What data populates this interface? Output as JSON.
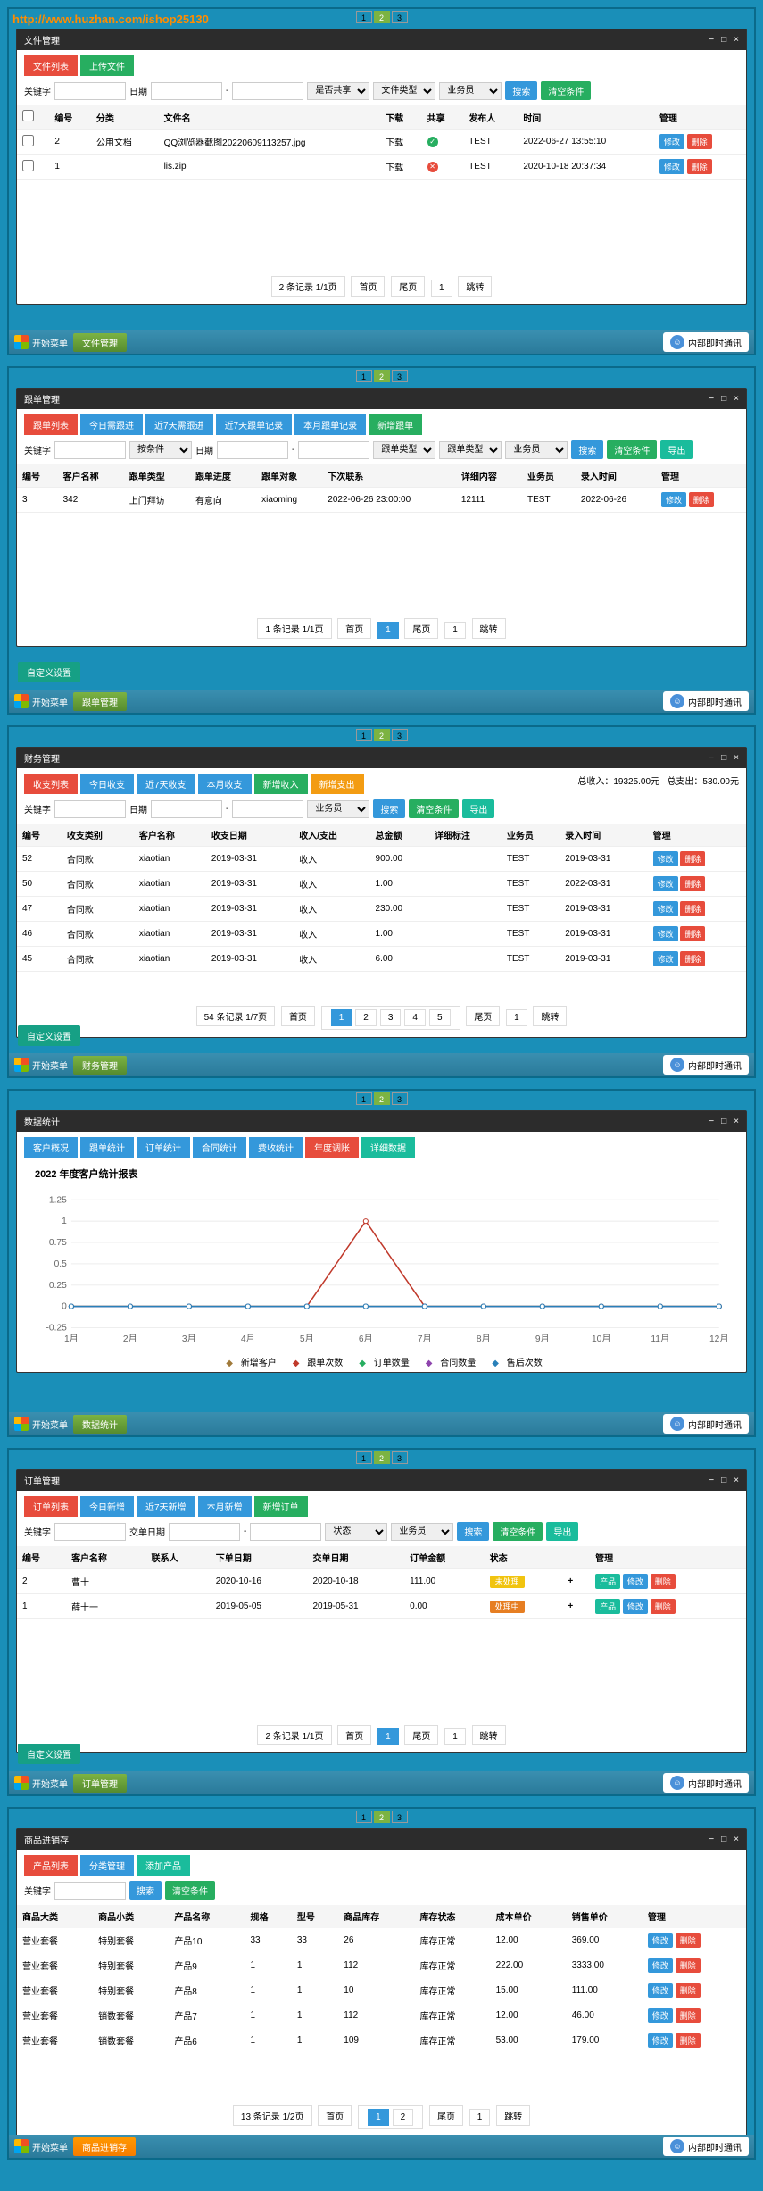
{
  "url_watermark": "http://www.huzhan.com/ishop25130",
  "top_pager": [
    "1",
    "2",
    "3"
  ],
  "taskbar": {
    "start": "开始菜单",
    "im": "内部即时通讯"
  },
  "common": {
    "keyword_label": "关键字",
    "search": "搜索",
    "clear": "清空条件",
    "export": "导出",
    "first_page": "首页",
    "last_page": "尾页",
    "jump": "跳转",
    "edit": "修改",
    "delete": "删除",
    "product": "产品",
    "custom_settings": "自定义设置",
    "manage": "管理",
    "download": "下载"
  },
  "s1": {
    "title": "文件管理",
    "tabs": [
      "文件列表",
      "上传文件"
    ],
    "selects": [
      "是否共享",
      "文件类型",
      "业务员"
    ],
    "task": "文件管理",
    "cols": [
      "编号",
      "分类",
      "文件名",
      "下载",
      "共享",
      "发布人",
      "时间",
      "管理"
    ],
    "pager_text": "2 条记录 1/1页",
    "rows": [
      {
        "id": "2",
        "cat": "公用文档",
        "name": "QQ浏览器截图20220609113257.jpg",
        "share": "✓",
        "pub": "TEST",
        "time": "2022-06-27 13:55:10"
      },
      {
        "id": "1",
        "cat": "",
        "name": "lis.zip",
        "share": "✕",
        "pub": "TEST",
        "time": "2020-10-18 20:37:34"
      }
    ]
  },
  "s2": {
    "title": "跟单管理",
    "tabs": [
      "跟单列表",
      "今日需跟进",
      "近7天需跟进",
      "近7天跟单记录",
      "本月跟单记录",
      "新增跟单"
    ],
    "selects": [
      "按条件",
      "日期",
      "跟单类型",
      "跟单类型",
      "业务员"
    ],
    "task": "跟单管理",
    "cols": [
      "编号",
      "客户名称",
      "跟单类型",
      "跟单进度",
      "跟单对象",
      "下次联系",
      "详细内容",
      "业务员",
      "录入时间",
      "管理"
    ],
    "pager_text": "1 条记录 1/1页",
    "rows": [
      {
        "id": "3",
        "cust": "342",
        "type": "上门拜访",
        "prog": "有意向",
        "obj": "xiaoming",
        "next": "2022-06-26 23:00:00",
        "detail": "12111",
        "emp": "TEST",
        "time": "2022-06-26"
      }
    ]
  },
  "s3": {
    "title": "财务管理",
    "tabs": [
      "收支列表",
      "今日收支",
      "近7天收支",
      "本月收支",
      "新增收入",
      "新增支出"
    ],
    "summary": {
      "in_label": "总收入：",
      "in": "19325.00元",
      "out_label": "总支出：",
      "out": "530.00元"
    },
    "selects": [
      "日期",
      "业务员"
    ],
    "task": "财务管理",
    "cols": [
      "编号",
      "收支类别",
      "客户名称",
      "收支日期",
      "收入/支出",
      "总金额",
      "详细标注",
      "业务员",
      "录入时间",
      "管理"
    ],
    "pager_text": "54 条记录 1/7页",
    "pages": [
      "1",
      "2",
      "3",
      "4",
      "5"
    ],
    "rows": [
      {
        "id": "52",
        "cat": "合同款",
        "cust": "xiaotian",
        "date": "2019-03-31",
        "io": "收入",
        "amt": "900.00",
        "emp": "TEST",
        "time": "2019-03-31"
      },
      {
        "id": "50",
        "cat": "合同款",
        "cust": "xiaotian",
        "date": "2019-03-31",
        "io": "收入",
        "amt": "1.00",
        "emp": "TEST",
        "time": "2022-03-31"
      },
      {
        "id": "47",
        "cat": "合同款",
        "cust": "xiaotian",
        "date": "2019-03-31",
        "io": "收入",
        "amt": "230.00",
        "emp": "TEST",
        "time": "2019-03-31"
      },
      {
        "id": "46",
        "cat": "合同款",
        "cust": "xiaotian",
        "date": "2019-03-31",
        "io": "收入",
        "amt": "1.00",
        "emp": "TEST",
        "time": "2019-03-31"
      },
      {
        "id": "45",
        "cat": "合同款",
        "cust": "xiaotian",
        "date": "2019-03-31",
        "io": "收入",
        "amt": "6.00",
        "emp": "TEST",
        "time": "2019-03-31"
      }
    ]
  },
  "s4": {
    "title": "数据统计",
    "tabs": [
      "客户概况",
      "跟单统计",
      "订单统计",
      "合同统计",
      "费收统计",
      "年度调账",
      "详细数据"
    ],
    "chart_title": "2022 年度客户统计报表",
    "task": "数据统计",
    "legend": [
      "新增客户",
      "跟单次数",
      "订单数量",
      "合同数量",
      "售后次数"
    ]
  },
  "s5": {
    "title": "订单管理",
    "tabs": [
      "订单列表",
      "今日新增",
      "近7天新增",
      "本月新增",
      "新增订单"
    ],
    "filters": {
      "date_label": "交单日期",
      "status": "状态",
      "emp": "业务员"
    },
    "task": "订单管理",
    "cols": [
      "编号",
      "客户名称",
      "联系人",
      "下单日期",
      "交单日期",
      "订单金额",
      "状态",
      "管理"
    ],
    "pager_text": "2 条记录 1/1页",
    "rows": [
      {
        "id": "2",
        "cust": "曹十",
        "contact": "",
        "order": "2020-10-16",
        "deliver": "2020-10-18",
        "amt": "111.00",
        "status": "未处理"
      },
      {
        "id": "1",
        "cust": "薛十一",
        "contact": "",
        "order": "2019-05-05",
        "deliver": "2019-05-31",
        "amt": "0.00",
        "status": "处理中"
      }
    ]
  },
  "s6": {
    "title": "商品进销存",
    "tabs": [
      "产品列表",
      "分类管理",
      "添加产品"
    ],
    "task": "商品进销存",
    "cols": [
      "商品大类",
      "商品小类",
      "产品名称",
      "规格",
      "型号",
      "商品库存",
      "库存状态",
      "成本单价",
      "销售单价",
      "管理"
    ],
    "pager_text": "13 条记录 1/2页",
    "pages": [
      "1",
      "2"
    ],
    "rows": [
      {
        "c1": "营业套餐",
        "c2": "特别套餐",
        "name": "产品10",
        "spec": "33",
        "model": "33",
        "stock": "26",
        "status": "库存正常",
        "cost": "12.00",
        "price": "369.00"
      },
      {
        "c1": "营业套餐",
        "c2": "特别套餐",
        "name": "产品9",
        "spec": "1",
        "model": "1",
        "stock": "112",
        "status": "库存正常",
        "cost": "222.00",
        "price": "3333.00"
      },
      {
        "c1": "营业套餐",
        "c2": "特别套餐",
        "name": "产品8",
        "spec": "1",
        "model": "1",
        "stock": "10",
        "status": "库存正常",
        "cost": "15.00",
        "price": "111.00"
      },
      {
        "c1": "营业套餐",
        "c2": "销数套餐",
        "name": "产品7",
        "spec": "1",
        "model": "1",
        "stock": "112",
        "status": "库存正常",
        "cost": "12.00",
        "price": "46.00"
      },
      {
        "c1": "营业套餐",
        "c2": "销数套餐",
        "name": "产品6",
        "spec": "1",
        "model": "1",
        "stock": "109",
        "status": "库存正常",
        "cost": "53.00",
        "price": "179.00"
      }
    ]
  },
  "chart_data": {
    "type": "line",
    "title": "2022 年度客户统计报表",
    "xlabel": "月",
    "ylabel": "",
    "categories": [
      "1月",
      "2月",
      "3月",
      "4月",
      "5月",
      "6月",
      "7月",
      "8月",
      "9月",
      "10月",
      "11月",
      "12月"
    ],
    "ylim": [
      -0.25,
      1.25
    ],
    "yticks": [
      -0.25,
      0,
      0.25,
      0.5,
      0.75,
      1,
      1.25
    ],
    "series": [
      {
        "name": "新增客户",
        "color": "#a07a3a",
        "values": [
          0,
          0,
          0,
          0,
          0,
          0,
          0,
          0,
          0,
          0,
          0,
          0
        ]
      },
      {
        "name": "跟单次数",
        "color": "#c0392b",
        "values": [
          0,
          0,
          0,
          0,
          0,
          1,
          0,
          0,
          0,
          0,
          0,
          0
        ]
      },
      {
        "name": "订单数量",
        "color": "#27ae60",
        "values": [
          0,
          0,
          0,
          0,
          0,
          0,
          0,
          0,
          0,
          0,
          0,
          0
        ]
      },
      {
        "name": "合同数量",
        "color": "#8e44ad",
        "values": [
          0,
          0,
          0,
          0,
          0,
          0,
          0,
          0,
          0,
          0,
          0,
          0
        ]
      },
      {
        "name": "售后次数",
        "color": "#2980b9",
        "values": [
          0,
          0,
          0,
          0,
          0,
          0,
          0,
          0,
          0,
          0,
          0,
          0
        ]
      }
    ]
  }
}
